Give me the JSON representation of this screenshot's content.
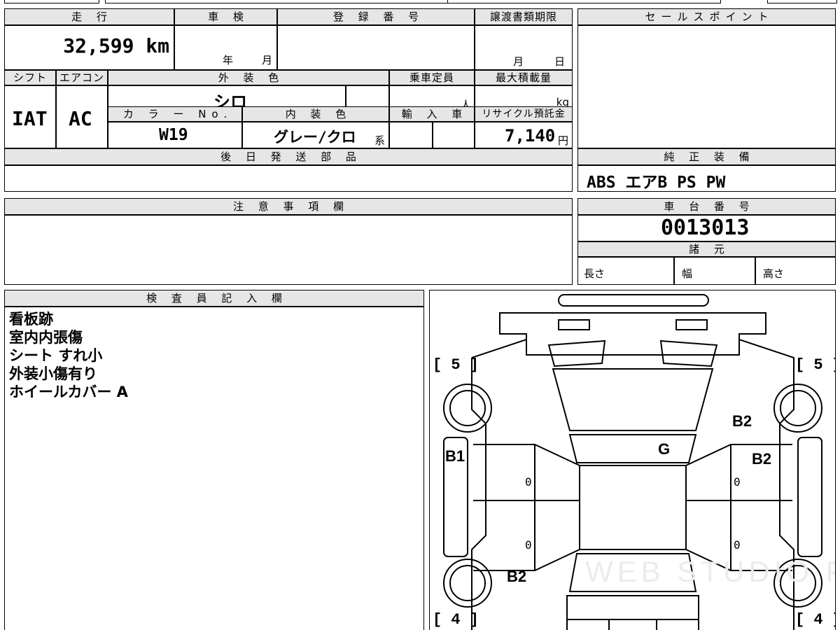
{
  "vehicle": {
    "mileage_label": "走 行",
    "mileage": "32,599 km",
    "inspection_label": "車 検",
    "inspection_year_unit": "年",
    "inspection_month_unit": "月",
    "registration_label": "登 録 番 号",
    "registration_value": "",
    "transfer_deadline_label": "譲渡書類期限",
    "transfer_month_unit": "月",
    "transfer_day_unit": "日",
    "shift_label": "シフト",
    "shift_value": "IAT",
    "aircon_label": "エアコン",
    "aircon_value": "AC",
    "exterior_color_label": "外 装 色",
    "exterior_color_value": "シロ",
    "capacity_label": "乗車定員",
    "capacity_unit": "人",
    "max_load_label": "最大積載量",
    "max_load_unit": "kg",
    "color_no_label": "カ ラ ー No.",
    "color_no_value": "W19",
    "interior_color_label": "内 装 色",
    "interior_color_value": "グレー/クロ",
    "interior_color_suffix": "系",
    "import_label": "輸 入 車",
    "recycle_label": "リサイクル預託金",
    "recycle_value": "7,140",
    "recycle_unit": "円",
    "later_parts_label": "後 日 発 送 部 品"
  },
  "sales_point": {
    "label": "セールスポイント"
  },
  "equipment": {
    "label": "純 正 装 備",
    "value": "ABS エアB PS PW"
  },
  "notes": {
    "label": "注 意 事 項 欄"
  },
  "chassis": {
    "label": "車 台 番 号",
    "value": "0013013",
    "spec_label": "諸 元",
    "length_label": "長さ",
    "width_label": "幅",
    "height_label": "高さ"
  },
  "inspector": {
    "label": "検 査 員 記 入 欄",
    "lines": [
      "看板跡",
      "室内内張傷",
      "シート すれ小",
      "外装小傷有り",
      "ホイールカバー A"
    ]
  },
  "diagram": {
    "tire_front_left": "[ 5 ]",
    "tire_front_right": "[ 5 ]",
    "tire_rear_left": "[ 4 ]",
    "tire_rear_right": "[ 4 ]",
    "marks": {
      "b2_front_right": "B2",
      "g_windshield": "G",
      "b1_left": "B1",
      "b2_right": "B2",
      "b2_rear_left": "B2"
    },
    "zeros": [
      "0",
      "0",
      "0",
      "0"
    ],
    "watermark": "WEB STUDIO PRO"
  }
}
